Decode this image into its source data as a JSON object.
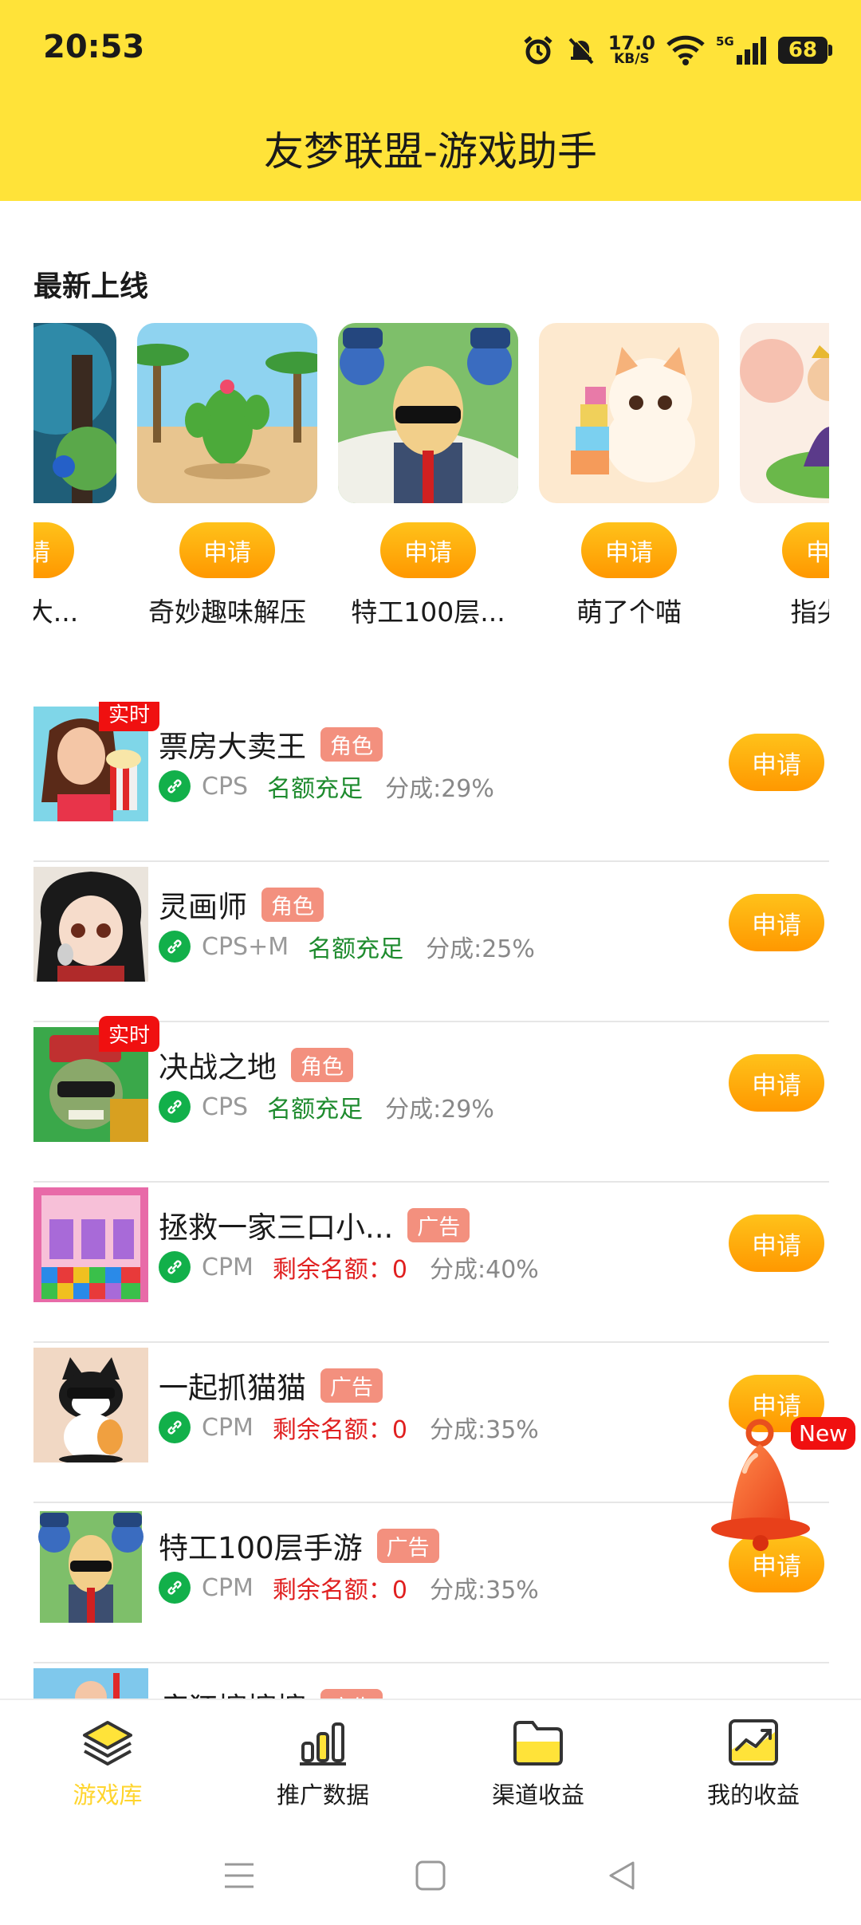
{
  "status_bar": {
    "time": "20:53",
    "speed_value": "17.0",
    "speed_unit": "KB/S",
    "network": "5G",
    "battery": "68"
  },
  "header": {
    "title": "友梦联盟-游戏助手"
  },
  "latest": {
    "title": "最新上线",
    "items": [
      {
        "name": "连连大...",
        "button": "申请"
      },
      {
        "name": "奇妙趣味解压",
        "button": "申请"
      },
      {
        "name": "特工100层...",
        "button": "申请"
      },
      {
        "name": "萌了个喵",
        "button": "申请"
      },
      {
        "name": "指尖娱",
        "button": "申请"
      }
    ]
  },
  "games": [
    {
      "name": "票房大卖王",
      "tag": "角色",
      "badge": "实时",
      "model": "CPS",
      "quota": "名额充足",
      "share": "分成:29%",
      "button": "申请"
    },
    {
      "name": "灵画师",
      "tag": "角色",
      "badge": "",
      "model": "CPS+M",
      "quota": "名额充足",
      "share": "分成:25%",
      "button": "申请"
    },
    {
      "name": "决战之地",
      "tag": "角色",
      "badge": "实时",
      "model": "CPS",
      "quota": "名额充足",
      "share": "分成:29%",
      "button": "申请"
    },
    {
      "name": "拯救一家三口小...",
      "tag": "广告",
      "badge": "",
      "model": "CPM",
      "quota": "剩余名额：0",
      "share": "分成:40%",
      "button": "申请"
    },
    {
      "name": "一起抓猫猫",
      "tag": "广告",
      "badge": "",
      "model": "CPM",
      "quota": "剩余名额：0",
      "share": "分成:35%",
      "button": "申请"
    },
    {
      "name": "特工100层手游",
      "tag": "广告",
      "badge": "",
      "model": "CPM",
      "quota": "剩余名额：0",
      "share": "分成:35%",
      "button": "申请"
    },
    {
      "name": "疯狂擦擦擦",
      "tag": "广告",
      "badge": "",
      "model": "",
      "quota": "",
      "share": "",
      "button": ""
    }
  ],
  "floating": {
    "new_badge": "New"
  },
  "bottom_nav": [
    {
      "label": "游戏库",
      "active": true
    },
    {
      "label": "推广数据",
      "active": false
    },
    {
      "label": "渠道收益",
      "active": false
    },
    {
      "label": "我的收益",
      "active": false
    }
  ],
  "colors": {
    "header_bg": "#FFE339",
    "button": "#FF9800",
    "tag": "#F3907E",
    "live_badge": "#F01010",
    "quota_ok": "#1E8B2E",
    "quota_none": "#E02020"
  }
}
